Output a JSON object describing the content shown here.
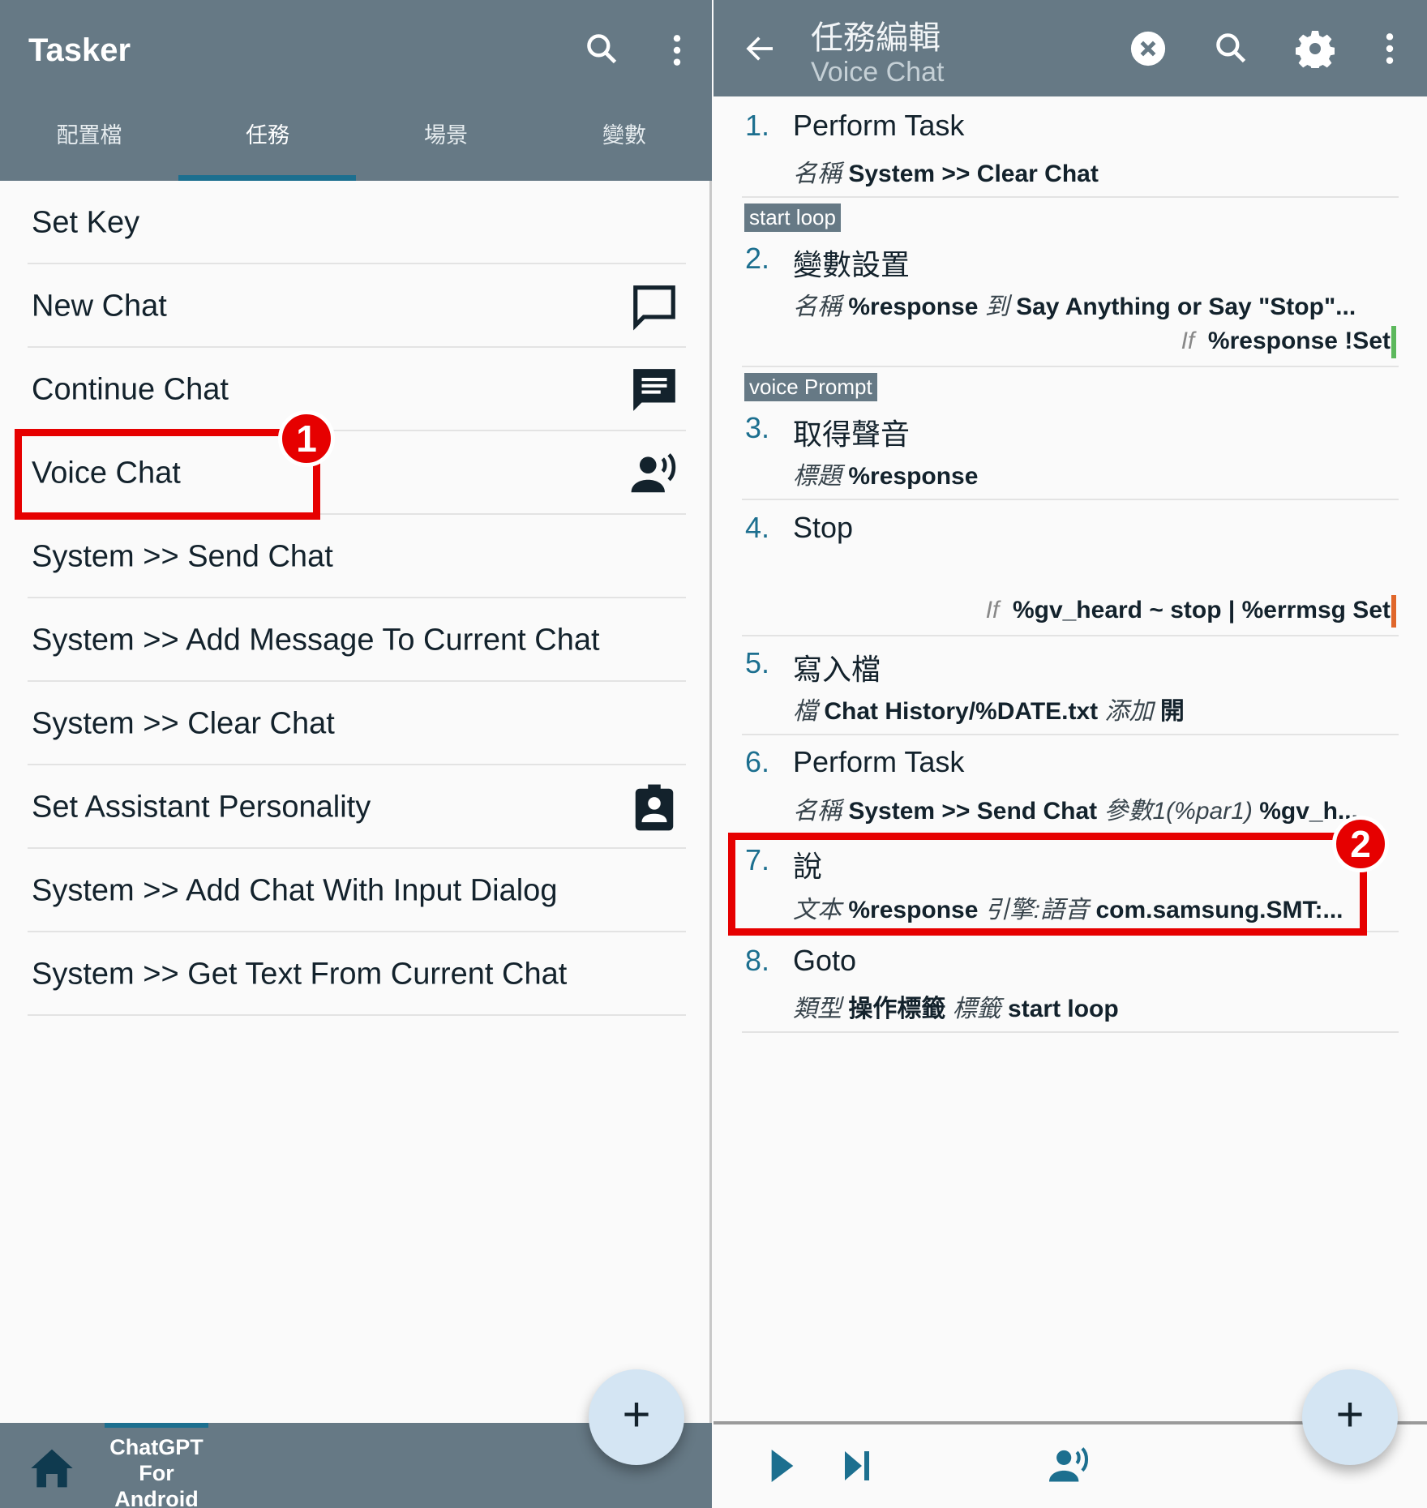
{
  "left": {
    "app_title": "Tasker",
    "tabs": [
      {
        "label": "配置檔"
      },
      {
        "label": "任務",
        "active": true
      },
      {
        "label": "場景"
      },
      {
        "label": "變數"
      }
    ],
    "tasks": [
      {
        "name": "Set Key"
      },
      {
        "name": "New Chat",
        "icon": "chat-bubble-outline-icon"
      },
      {
        "name": "Continue Chat",
        "icon": "chat-bubble-text-icon"
      },
      {
        "name": "Voice Chat",
        "icon": "voice-person-icon"
      },
      {
        "name": "System >> Send Chat"
      },
      {
        "name": "System >> Add Message To Current Chat"
      },
      {
        "name": "System >> Clear Chat"
      },
      {
        "name": "Set Assistant Personality",
        "icon": "clipboard-person-icon"
      },
      {
        "name": "System >> Add Chat With Input Dialog"
      },
      {
        "name": "System >> Get Text From Current Chat"
      }
    ],
    "bottom_project": "ChatGPT For Android",
    "badge": "1",
    "fab": "+"
  },
  "right": {
    "title": "任務編輯",
    "subtitle": "Voice Chat",
    "steps": [
      {
        "num": "1.",
        "title": "Perform Task",
        "sub": [
          [
            "名稱",
            "System >> Clear Chat"
          ]
        ]
      },
      {
        "num": "2.",
        "label": "start loop",
        "title": "變數設置",
        "sub": [
          [
            "名稱",
            "%response"
          ],
          [
            "到",
            "Say Anything or Say \"Stop\"..."
          ]
        ],
        "cond": [
          "If",
          "%response !Set"
        ],
        "cond_color": "#5cb85c"
      },
      {
        "num": "3.",
        "label": "voice Prompt",
        "title": "取得聲音",
        "sub": [
          [
            "標題",
            "%response"
          ]
        ]
      },
      {
        "num": "4.",
        "title": "Stop",
        "cond": [
          "If",
          "%gv_heard ~ stop | %errmsg Set"
        ],
        "cond_color": "#e0662a"
      },
      {
        "num": "5.",
        "title": "寫入檔",
        "sub": [
          [
            "檔",
            "Chat History/%DATE.txt"
          ],
          [
            "添加",
            "開"
          ]
        ]
      },
      {
        "num": "6.",
        "title": "Perform Task",
        "sub": [
          [
            "名稱",
            "System >> Send Chat"
          ],
          [
            "參數1(%par1)",
            "%gv_h..."
          ]
        ]
      },
      {
        "num": "7.",
        "title": "說",
        "sub": [
          [
            "文本",
            "%response"
          ],
          [
            "引擎:語音",
            "com.samsung.SMT:..."
          ]
        ]
      },
      {
        "num": "8.",
        "title": "Goto",
        "sub": [
          [
            "類型",
            "操作標籤"
          ],
          [
            "標籤",
            "start loop"
          ]
        ]
      }
    ],
    "badge": "2",
    "fab": "+"
  },
  "colors": {
    "header": "#667985",
    "accent": "#1c6f8f",
    "highlight": "#e60000"
  }
}
